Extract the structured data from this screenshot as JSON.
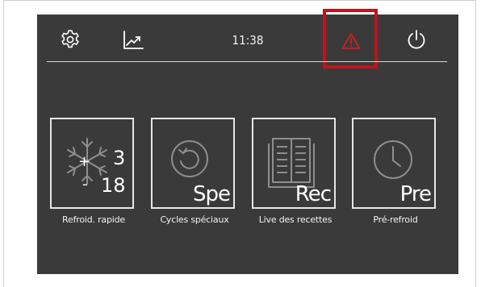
{
  "header": {
    "time": "11:38",
    "icons": [
      "settings-gear-icon",
      "trend-chart-icon",
      "warning-triangle-icon",
      "power-icon"
    ],
    "alert_color": "#d21f1f",
    "highlight_color": "#c0141c"
  },
  "tiles": [
    {
      "id": "quick-chill",
      "caption": "Refroid. rapide",
      "icon": "snowflake-icon",
      "value_top": "3",
      "value_bottom": "18",
      "sign_plus": "+",
      "sign_minus": "-"
    },
    {
      "id": "special-cycles",
      "caption": "Cycles spéciaux",
      "icon": "cycle-icon",
      "code": "Spe"
    },
    {
      "id": "recipes",
      "caption": "Live des recettes",
      "icon": "book-icon",
      "code": "Rec"
    },
    {
      "id": "pre-chill",
      "caption": "Pré-refroid",
      "icon": "clock-icon",
      "code": "Pre"
    }
  ],
  "colors": {
    "screen": "#3a3a3a",
    "frame": "#ffffff",
    "text": "#ffffff"
  }
}
